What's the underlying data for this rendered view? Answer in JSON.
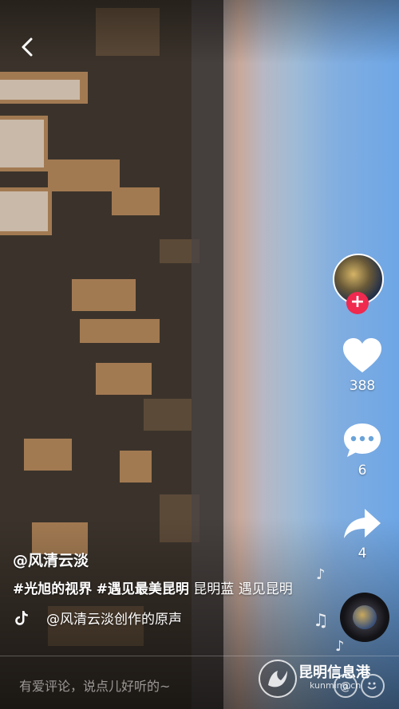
{
  "video": {
    "scene": "city-skyline-rotated"
  },
  "nav": {
    "back_icon": "chevron-left-icon"
  },
  "author": {
    "handle": "@风清云淡"
  },
  "actions": {
    "like_count": "388",
    "comment_count": "6",
    "share_count": "4"
  },
  "description": {
    "tags": [
      "#光旭的视界",
      "#遇见最美昆明"
    ],
    "text": " 昆明蓝 遇见昆明"
  },
  "music": {
    "label": "@风清云淡创作的原声"
  },
  "comment_bar": {
    "placeholder": "有爱评论，说点儿好听的~"
  },
  "watermark": {
    "name": "昆明信息港",
    "url": "kunming.cn"
  },
  "colors": {
    "follow": "#f0294f",
    "sky": "#6da6e6"
  }
}
